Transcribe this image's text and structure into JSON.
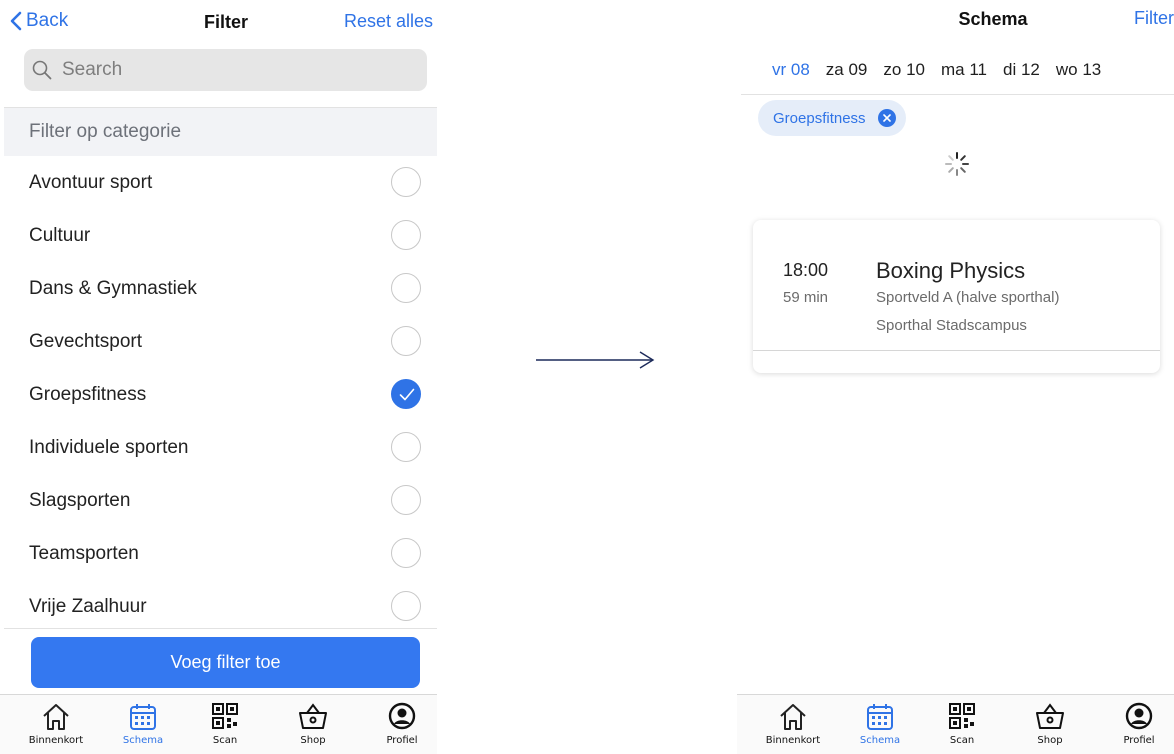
{
  "left": {
    "back_label": "Back",
    "title": "Filter",
    "reset_label": "Reset alles",
    "search_placeholder": "Search",
    "section_title": "Filter op categorie",
    "categories": [
      {
        "label": "Avontuur sport",
        "checked": false
      },
      {
        "label": "Cultuur",
        "checked": false
      },
      {
        "label": "Dans & Gymnastiek",
        "checked": false
      },
      {
        "label": "Gevechtsport",
        "checked": false
      },
      {
        "label": "Groepsfitness",
        "checked": true
      },
      {
        "label": "Individuele sporten",
        "checked": false
      },
      {
        "label": "Slagsporten",
        "checked": false
      },
      {
        "label": "Teamsporten",
        "checked": false
      },
      {
        "label": "Vrije Zaalhuur",
        "checked": false
      }
    ],
    "apply_label": "Voeg filter toe"
  },
  "right": {
    "title": "Schema",
    "filter_label": "Filter",
    "days": [
      "vr 08",
      "za 09",
      "zo 10",
      "ma 11",
      "di 12",
      "wo 13"
    ],
    "active_day": 0,
    "chip_label": "Groepsfitness",
    "event": {
      "time": "18:00",
      "duration": "59 min",
      "title": "Boxing Physics",
      "location": "Sportveld A (halve sporthal)",
      "venue": "Sporthal Stadscampus"
    }
  },
  "tabbar": {
    "tabs": [
      {
        "label": "Binnenkort",
        "icon": "home-icon"
      },
      {
        "label": "Schema",
        "icon": "calendar-icon",
        "active": true
      },
      {
        "label": "Scan",
        "icon": "qr-code-icon"
      },
      {
        "label": "Shop",
        "icon": "basket-icon"
      },
      {
        "label": "Profiel",
        "icon": "profile-icon"
      }
    ]
  },
  "colors": {
    "accent": "#2f73e6",
    "button": "#3478f0",
    "section_bg": "#f2f3f6",
    "chip_bg": "#e5edf9",
    "arrow": "#1c2a5a"
  }
}
